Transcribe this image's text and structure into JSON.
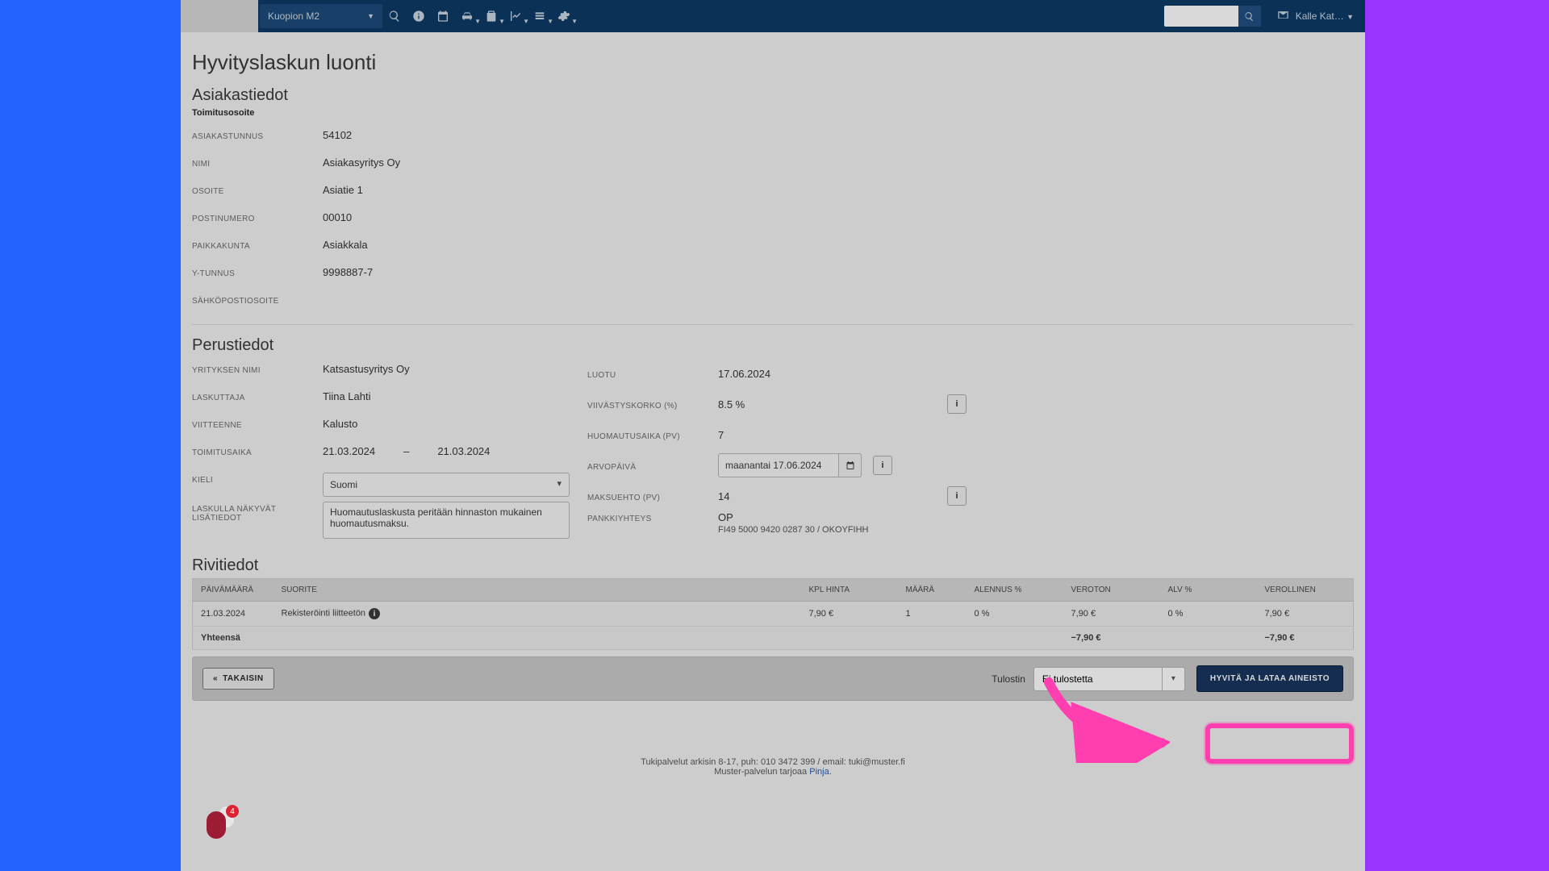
{
  "topbar": {
    "site_selected": "Kuopion M2",
    "user_label": "Kalle Kat…"
  },
  "page": {
    "title": "Hyvityslaskun luonti"
  },
  "customer": {
    "section_title": "Asiakastiedot",
    "delivery_heading": "Toimitusosoite",
    "fields": {
      "asiakastunnus_label": "ASIAKASTUNNUS",
      "asiakastunnus": "54102",
      "nimi_label": "NIMI",
      "nimi": "Asiakasyritys Oy",
      "osoite_label": "OSOITE",
      "osoite": "Asiatie 1",
      "postinumero_label": "POSTINUMERO",
      "postinumero": "00010",
      "paikkakunta_label": "PAIKKAKUNTA",
      "paikkakunta": "Asiakkala",
      "ytunnus_label": "Y-TUNNUS",
      "ytunnus": "9998887-7",
      "email_label": "SÄHKÖPOSTIOSOITE",
      "email": ""
    }
  },
  "basics": {
    "section_title": "Perustiedot",
    "left": {
      "yritys_label": "YRITYKSEN NIMI",
      "yritys": "Katsastusyritys Oy",
      "laskuttaja_label": "LASKUTTAJA",
      "laskuttaja": "Tiina Lahti",
      "viite_label": "VIITTEENNE",
      "viite": "Kalusto",
      "toimitusaika_label": "TOIMITUSAIKA",
      "toimitus_from": "21.03.2024",
      "toimitus_dash": "–",
      "toimitus_to": "21.03.2024",
      "kieli_label": "KIELI",
      "kieli_selected": "Suomi",
      "lisatiedot_label": "LASKULLA NÄKYVÄT LISÄTIEDOT",
      "lisatiedot_value": "Huomautuslaskusta peritään hinnaston mukainen huomautusmaksu."
    },
    "right": {
      "luotu_label": "LUOTU",
      "luotu": "17.06.2024",
      "viivastyskorko_label": "VIIVÄSTYSKORKO (%)",
      "viivastyskorko": "8.5 %",
      "huomautusaika_label": "HUOMAUTUSAIKA (PV)",
      "huomautusaika": "7",
      "arvopaiva_label": "ARVOPÄIVÄ",
      "arvopaiva_value": "maanantai 17.06.2024",
      "maksuehto_label": "MAKSUEHTO (PV)",
      "maksuehto": "14",
      "pankki_label": "PANKKIYHTEYS",
      "pankki_name": "OP",
      "pankki_iban": "FI49 5000 9420 0287 30 / OKOYFIHH"
    }
  },
  "lines": {
    "section_title": "Rivitiedot",
    "headers": {
      "pvm": "PÄIVÄMÄÄRÄ",
      "suorite": "SUORITE",
      "kpl": "KPL HINTA",
      "maara": "MÄÄRÄ",
      "alennus": "ALENNUS %",
      "veroton": "VEROTON",
      "alv": "ALV %",
      "verollinen": "VEROLLINEN"
    },
    "rows": [
      {
        "pvm": "21.03.2024",
        "suorite": "Rekisteröinti liitteetön",
        "kpl": "7,90 €",
        "maara": "1",
        "alennus": "0 %",
        "veroton": "7,90 €",
        "alv": "0 %",
        "verollinen": "7,90 €"
      }
    ],
    "total_label": "Yhteensä",
    "total_veroton": "−7,90 €",
    "total_verollinen": "−7,90 €"
  },
  "footer": {
    "back_label": "TAKAISIN",
    "printer_label": "Tulostin",
    "printer_selected": "Ei tulostetta",
    "primary_label": "HYVITÄ JA LATAA AINEISTO"
  },
  "pagefoot": {
    "line1": "Tukipalvelut arkisin 8-17, puh: 010 3472 399 / email: tuki@muster.fi",
    "line2a": "Muster-palvelun tarjoaa ",
    "line2b": "Pinja",
    "badge_count": "4"
  }
}
